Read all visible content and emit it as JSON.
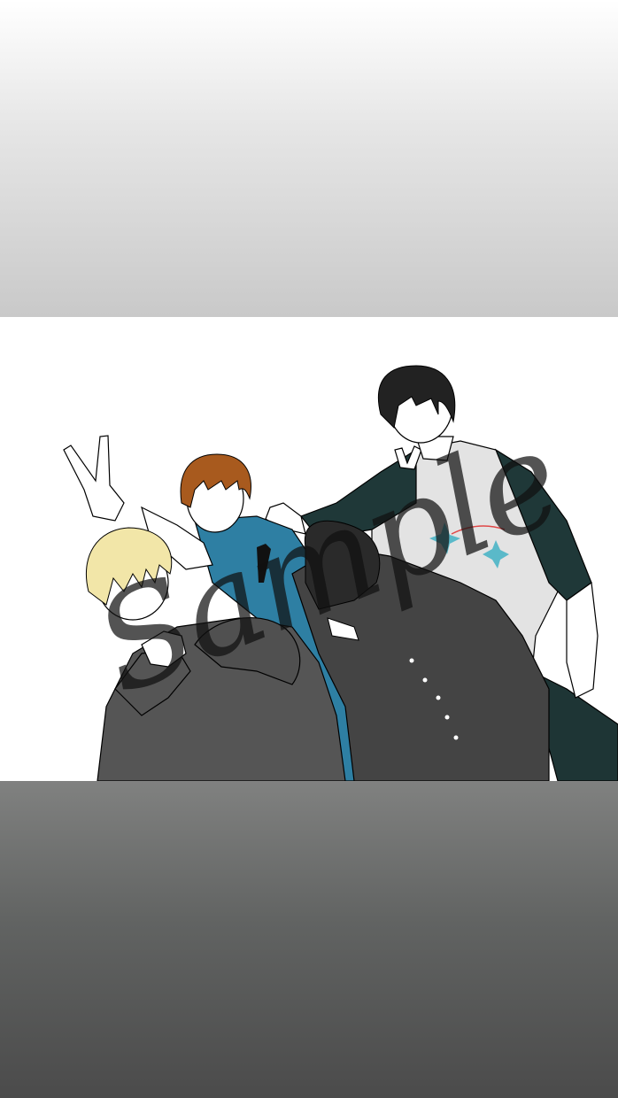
{
  "watermark": {
    "text": "Sample"
  },
  "colors": {
    "top_band_top": "#ffffff",
    "top_band_bottom": "#c9c9c9",
    "bottom_band_top": "#808180",
    "bottom_band_bottom": "#4b4b4b",
    "hoodie_gray": "#555555",
    "shirt_blue": "#2e7fa3",
    "hair_blonde": "#f2e6a8",
    "hair_brown": "#a85a1e",
    "hair_black": "#222222",
    "raglan_sleeve": "#1f3838",
    "raglan_body": "#e3e3e3",
    "tshirt_print_teal": "#5ab9c9",
    "tshirt_print_red": "#e04848"
  },
  "figures": [
    {
      "name": "blonde-hair-person",
      "hair": "blonde",
      "outfit": "gray-hoodie"
    },
    {
      "name": "brown-hair-person",
      "hair": "brown",
      "outfit": "blue-shirt"
    },
    {
      "name": "black-hair-leaning-person",
      "hair": "black",
      "outfit": "dark-shirt"
    },
    {
      "name": "black-hair-raglan-person",
      "hair": "black",
      "outfit": "raglan-tee"
    }
  ]
}
